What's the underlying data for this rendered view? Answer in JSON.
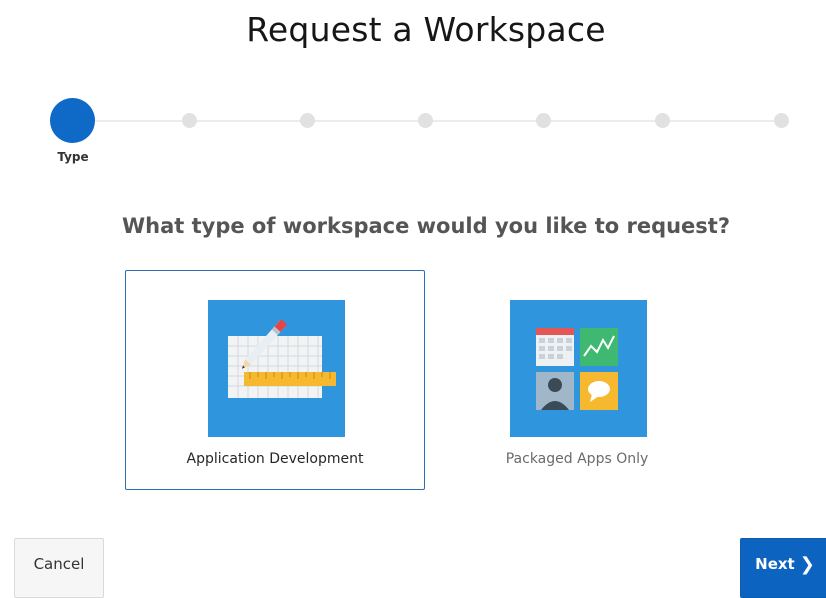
{
  "page": {
    "title": "Request a Workspace"
  },
  "wizard": {
    "current_step_label": "Type",
    "total_steps": 7,
    "current_step": 1
  },
  "question": "What type of workspace would you like to request?",
  "options": [
    {
      "label": "Application Development",
      "selected": true,
      "icon": "pencil-ruler-grid-icon"
    },
    {
      "label": "Packaged Apps Only",
      "selected": false,
      "icon": "packaged-apps-tiles-icon"
    }
  ],
  "buttons": {
    "cancel": "Cancel",
    "next": "Next"
  },
  "colors": {
    "primary": "#0d64c0",
    "tile": "#2f95dc",
    "step_inactive": "#e1e1e1",
    "selected_border": "#2b6fb0"
  }
}
